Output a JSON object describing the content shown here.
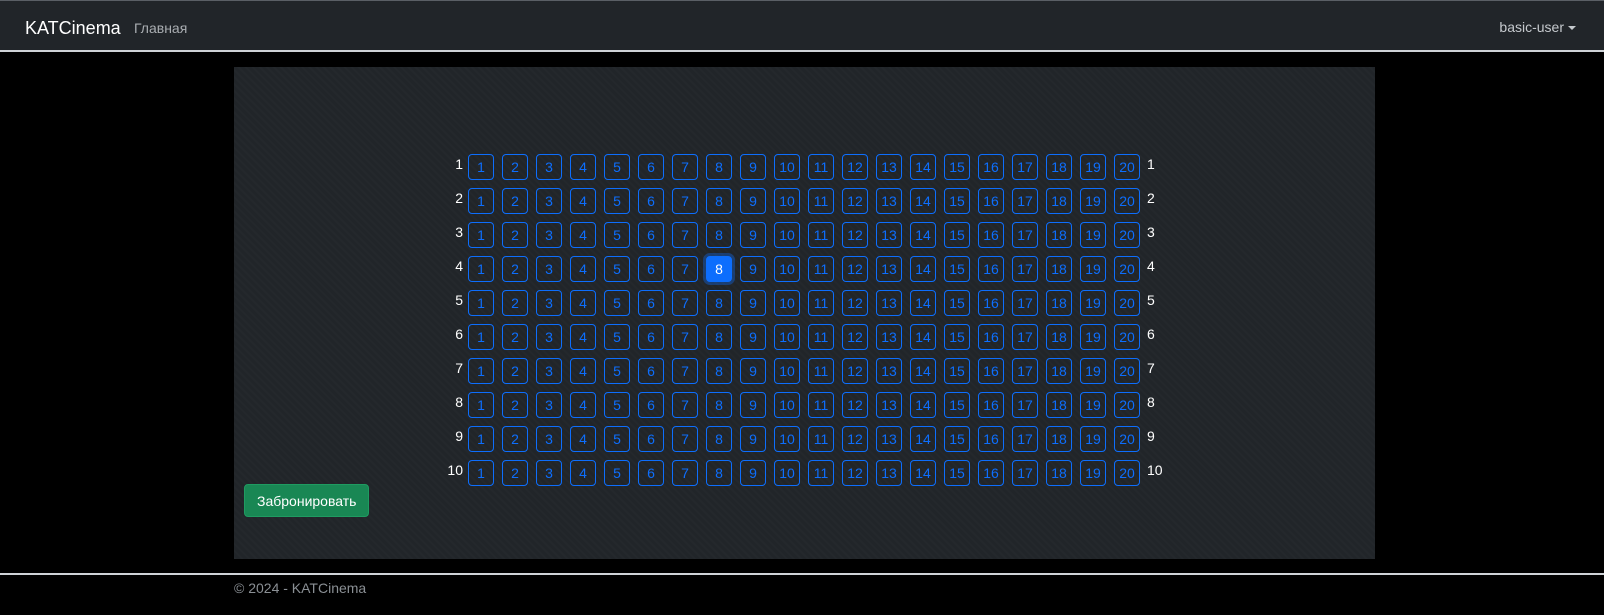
{
  "navbar": {
    "brand": "KATCinema",
    "links": [
      "Главная"
    ],
    "user": "basic-user"
  },
  "hall": {
    "rows": [
      1,
      2,
      3,
      4,
      5,
      6,
      7,
      8,
      9,
      10
    ],
    "seats_per_row": [
      1,
      2,
      3,
      4,
      5,
      6,
      7,
      8,
      9,
      10,
      11,
      12,
      13,
      14,
      15,
      16,
      17,
      18,
      19,
      20
    ],
    "selected": {
      "row": 4,
      "seat": 8
    },
    "colors": {
      "seat": "#0d6efd",
      "selected_bg": "#0d6efd",
      "book_button": "#198754"
    }
  },
  "actions": {
    "book_label": "Забронировать"
  },
  "footer": {
    "text": "© 2024 - KATCinema"
  }
}
